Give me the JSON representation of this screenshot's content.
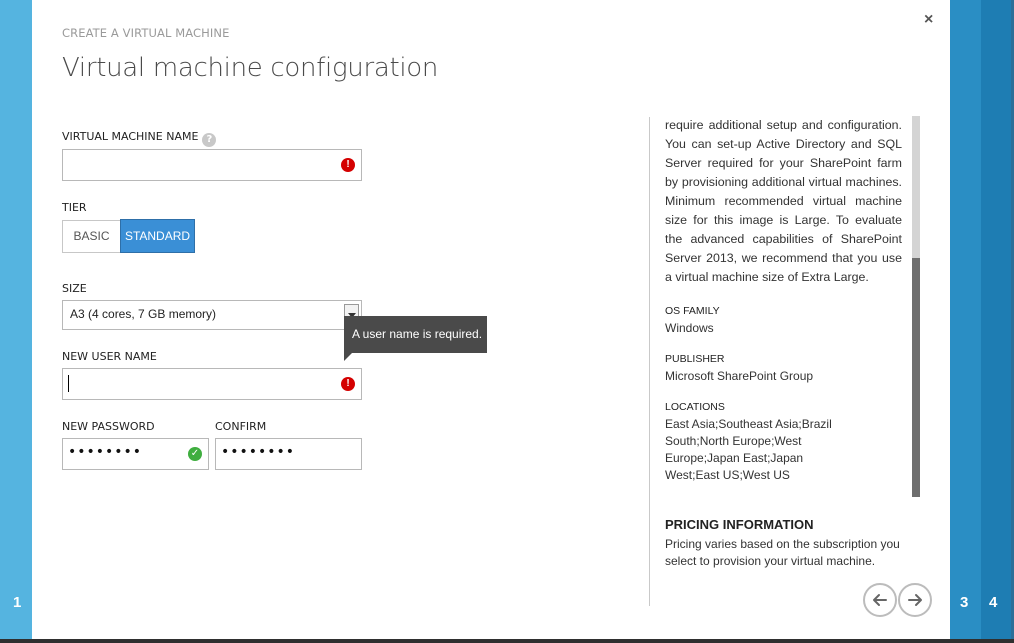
{
  "wizard": {
    "label": "CREATE A VIRTUAL MACHINE",
    "title": "Virtual machine configuration",
    "close_glyph": "×",
    "steps": [
      "1",
      "3",
      "4"
    ]
  },
  "form": {
    "vm_name": {
      "label": "VIRTUAL MACHINE NAME",
      "value": "",
      "help_glyph": "?",
      "error_glyph": "!"
    },
    "tier": {
      "label": "TIER",
      "options": [
        "BASIC",
        "STANDARD"
      ],
      "selected": "STANDARD"
    },
    "size": {
      "label": "SIZE",
      "selected": "A3 (4 cores, 7 GB memory)"
    },
    "username": {
      "label": "NEW USER NAME",
      "value": "",
      "error_glyph": "!"
    },
    "password": {
      "label": "NEW PASSWORD",
      "masked": "••••••••",
      "ok_glyph": "✓"
    },
    "confirm": {
      "label": "CONFIRM",
      "masked": "••••••••"
    }
  },
  "tooltip": {
    "text": "A user name is required."
  },
  "details": {
    "description": "require additional setup and configuration. You can set-up Active Directory and SQL Server required for your SharePoint farm by provisioning additional virtual machines. Minimum recommended virtual machine size for this image is Large. To evaluate the advanced capabilities of SharePoint Server 2013, we recommend that you use a virtual machine size of Extra Large.",
    "os_family": {
      "label": "OS FAMILY",
      "value": "Windows"
    },
    "publisher": {
      "label": "PUBLISHER",
      "value": "Microsoft SharePoint Group"
    },
    "locations": {
      "label": "LOCATIONS",
      "value": "East Asia;Southeast Asia;Brazil South;North Europe;West Europe;Japan East;Japan West;East US;West US"
    },
    "pricing": {
      "title": "PRICING INFORMATION",
      "text": "Pricing varies based on the subscription you select to provision your virtual machine."
    }
  },
  "colors": {
    "accent": "#3a8fd6",
    "rail_left": "#55b4e0",
    "rail_right": "#2a8ec4",
    "error": "#d40000",
    "ok": "#3fae3f"
  }
}
